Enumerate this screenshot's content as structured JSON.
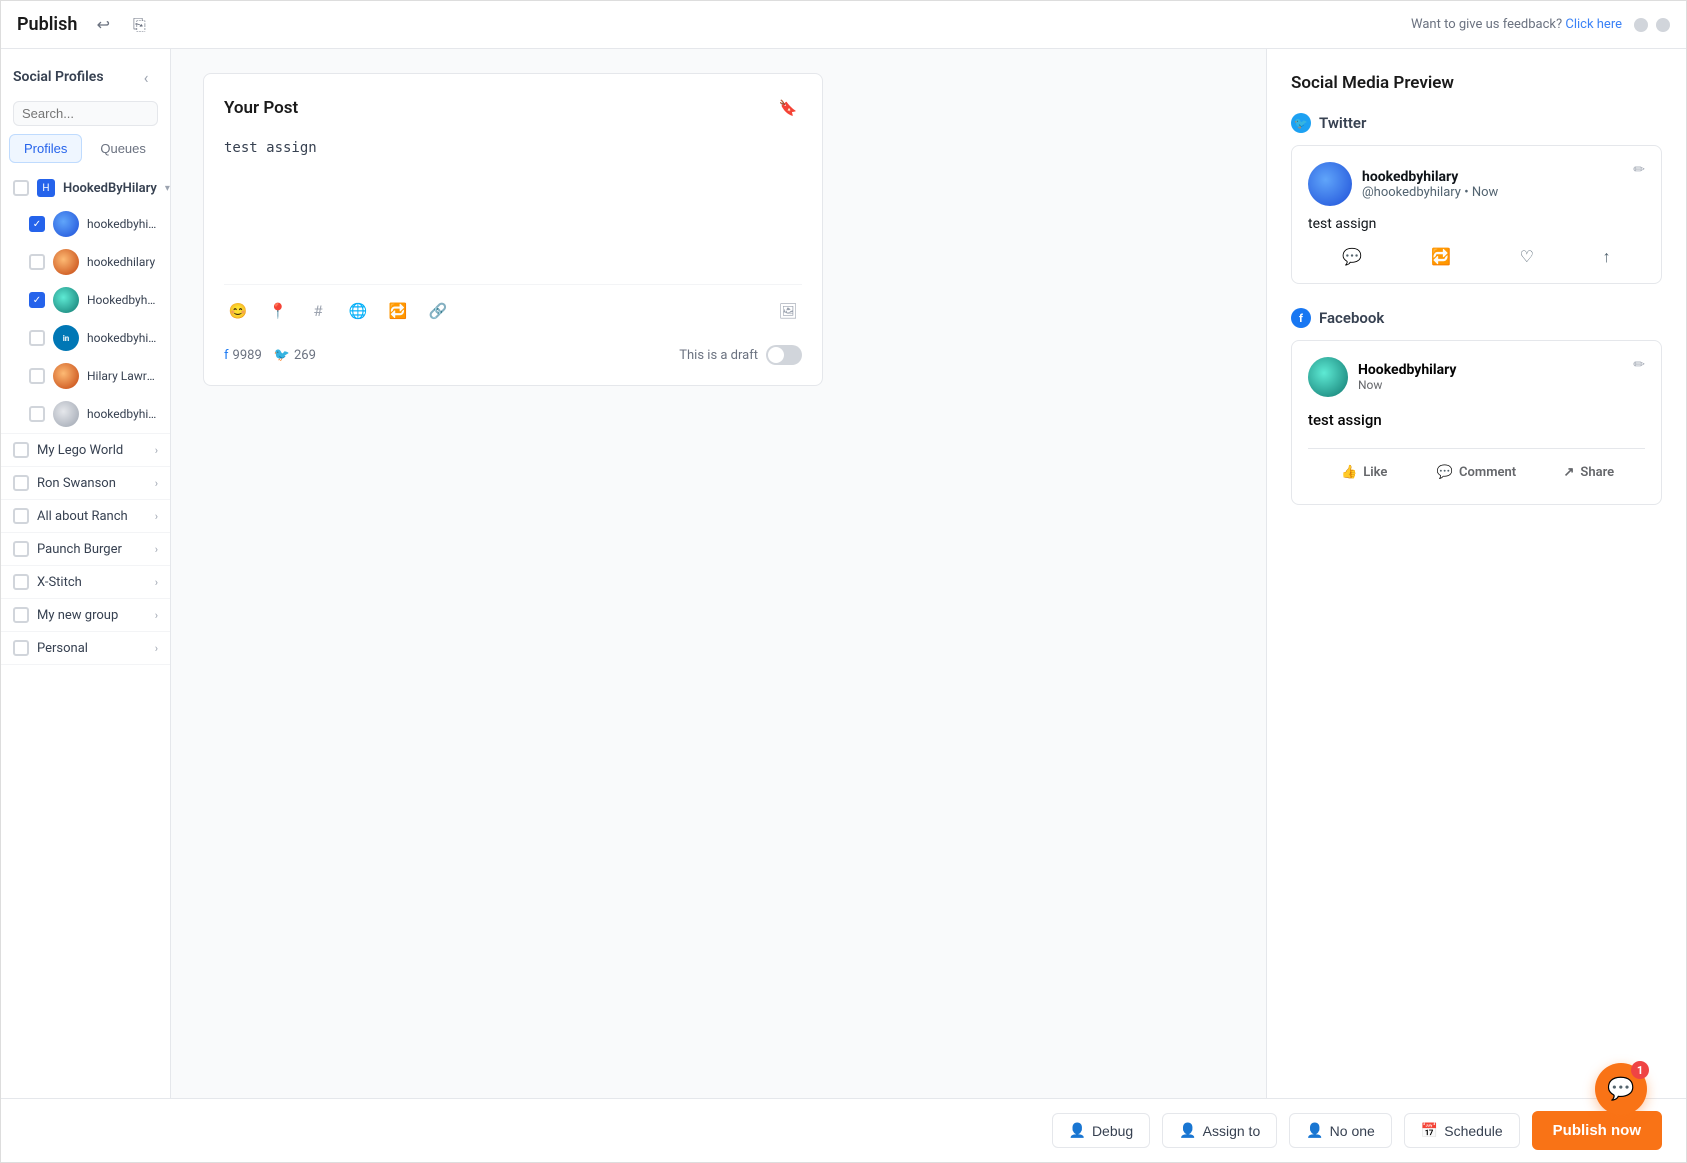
{
  "titleBar": {
    "title": "Publish",
    "feedbackText": "Want to give us feedback?",
    "feedbackLink": "Click here"
  },
  "sidebar": {
    "title": "Social Profiles",
    "searchPlaceholder": "Search...",
    "tabs": [
      {
        "label": "Profiles",
        "active": true
      },
      {
        "label": "Queues",
        "active": false
      }
    ],
    "mainGroup": {
      "name": "HookedByHilary",
      "checked": false,
      "profiles": [
        {
          "name": "hookedbyhilary",
          "checked": true,
          "platform": "twitter"
        },
        {
          "name": "hookedhilary",
          "checked": false,
          "platform": "instagram"
        },
        {
          "name": "Hookedbyhilary",
          "checked": true,
          "platform": "facebook"
        },
        {
          "name": "hookedbyhilary",
          "checked": false,
          "platform": "linkedin"
        },
        {
          "name": "Hilary Lawrence",
          "checked": false,
          "platform": "instagram2"
        },
        {
          "name": "hookedbyhilary",
          "checked": false,
          "platform": "youtube"
        }
      ]
    },
    "groups": [
      {
        "name": "My Lego World"
      },
      {
        "name": "Ron Swanson"
      },
      {
        "name": "All about Ranch"
      },
      {
        "name": "Paunch Burger"
      },
      {
        "name": "X-Stitch"
      },
      {
        "name": "My new group"
      },
      {
        "name": "Personal"
      }
    ]
  },
  "yourPost": {
    "title": "Your Post",
    "content": "test assign",
    "counts": {
      "facebook": "9989",
      "twitter": "269"
    },
    "draftLabel": "This is a draft"
  },
  "preview": {
    "title": "Social Media Preview",
    "twitter": {
      "platform": "Twitter",
      "displayName": "hookedbyhilary",
      "handle": "@hookedbyhilary",
      "time": "Now",
      "content": "test assign"
    },
    "facebook": {
      "platform": "Facebook",
      "displayName": "Hookedbyhilary",
      "time": "Now",
      "content": "test assign",
      "actions": [
        "Like",
        "Comment",
        "Share"
      ]
    }
  },
  "bottomBar": {
    "debugLabel": "Debug",
    "assignLabel": "Assign to",
    "assigneeLabel": "No one",
    "scheduleLabel": "Schedule",
    "publishLabel": "Publish now"
  },
  "chat": {
    "badge": "1"
  }
}
